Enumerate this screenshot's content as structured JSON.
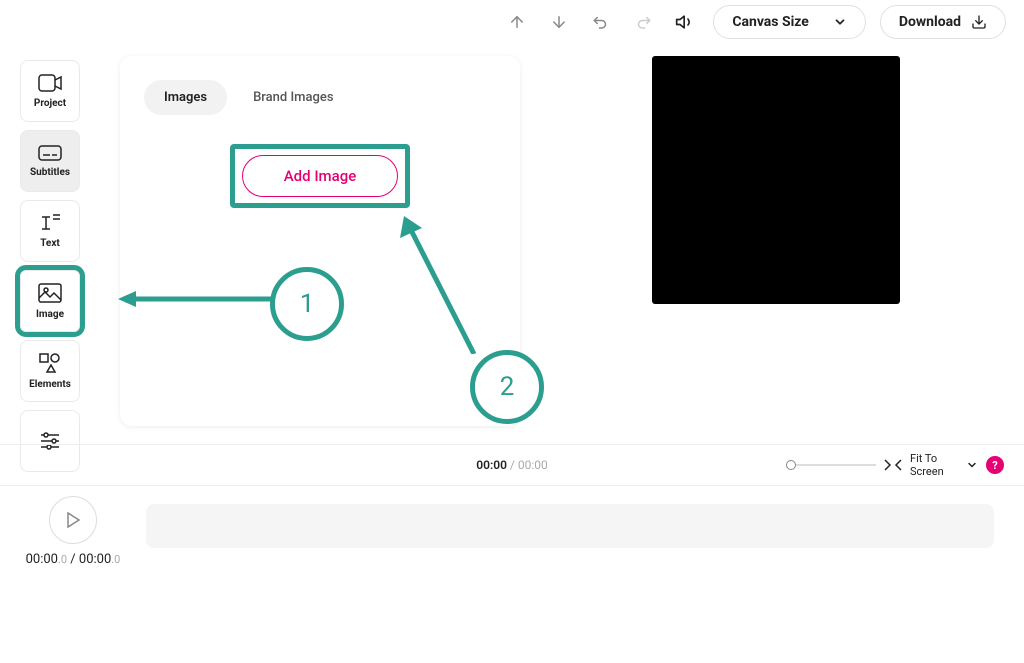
{
  "topbar": {
    "canvas_size": "Canvas Size",
    "download": "Download"
  },
  "sidebar": {
    "project": "Project",
    "subtitles": "Subtitles",
    "text": "Text",
    "image": "Image",
    "elements": "Elements"
  },
  "panel": {
    "tab_images": "Images",
    "tab_brand": "Brand Images",
    "add_image": "Add Image"
  },
  "annotations": {
    "one": "1",
    "two": "2"
  },
  "timeline": {
    "current": "00:00",
    "sep": " / ",
    "total": "00:00",
    "fit": "Fit To Screen",
    "help": "?"
  },
  "play": {
    "current": "00:00",
    "current_frac": ".0",
    "sep": " / ",
    "total": "00:00",
    "total_frac": ".0"
  }
}
